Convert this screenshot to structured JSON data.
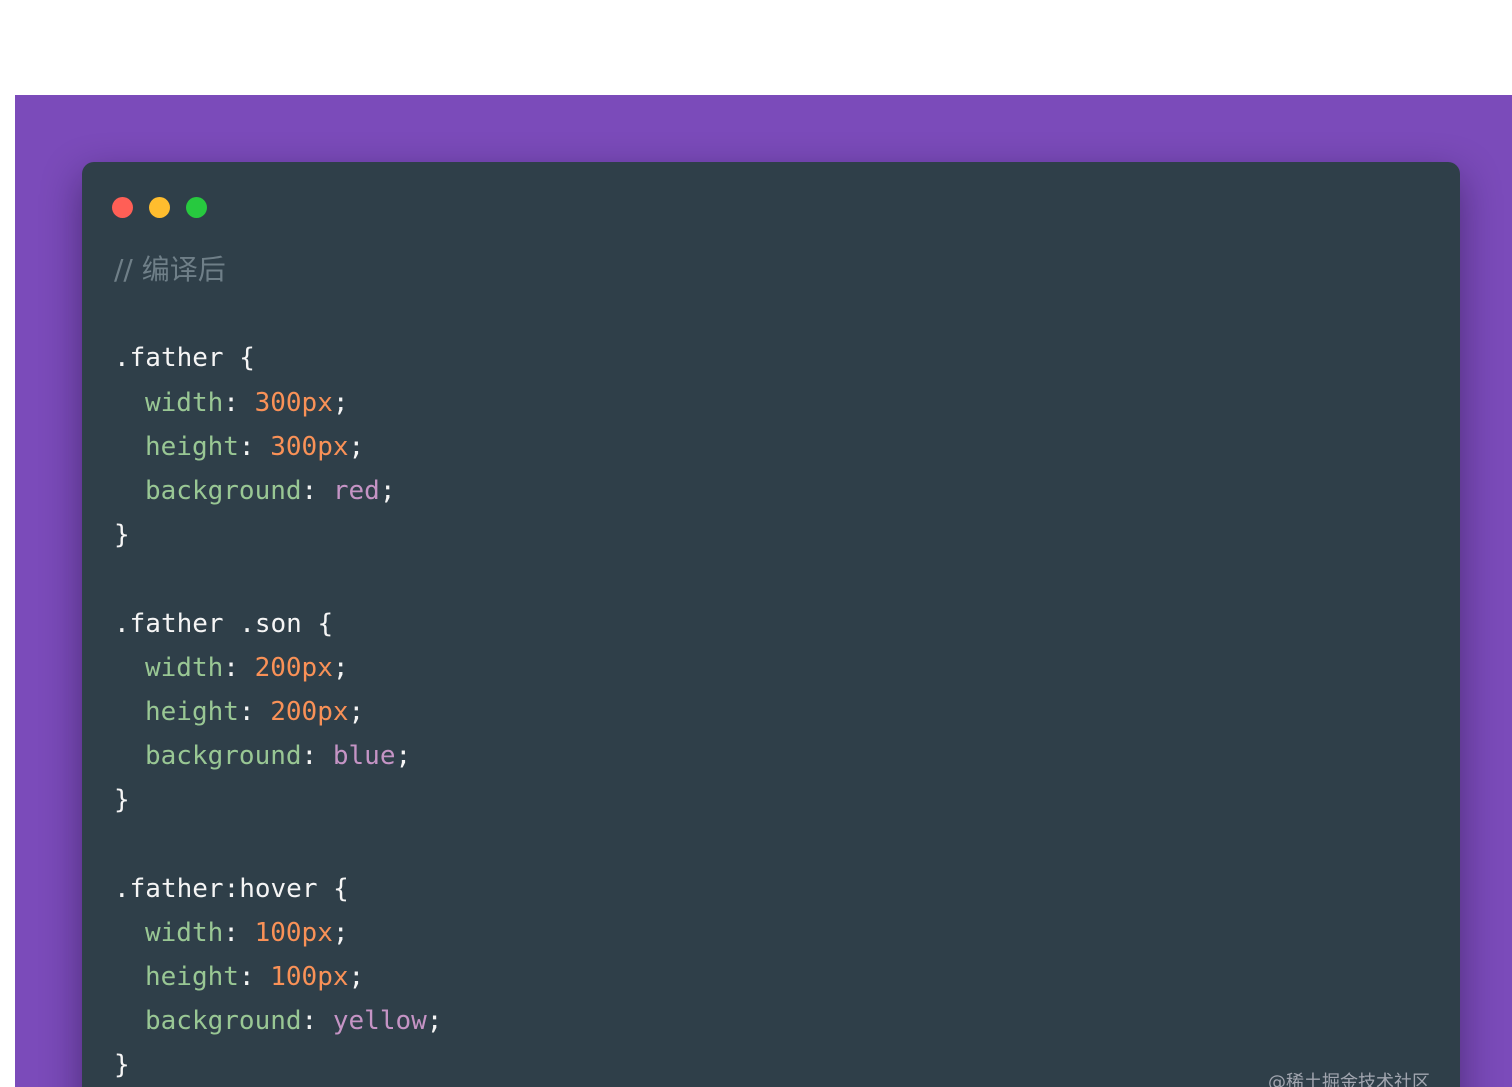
{
  "colors": {
    "backdrop": "#7b4bba",
    "window": "#2f3f49",
    "close_dot": "#ff5f56",
    "minimize_dot": "#ffbd2e",
    "maximize_dot": "#27c93f",
    "comment": "#6f7f88",
    "property": "#99c794",
    "number": "#f99157",
    "identifier": "#c594c5",
    "text": "#f5f5f5"
  },
  "window_controls": [
    "close-dot",
    "minimize-dot",
    "maximize-dot"
  ],
  "code": {
    "comment": "// 编译后",
    "blocks": [
      {
        "selector": ".father {",
        "declarations": [
          {
            "property": "width",
            "colon": ": ",
            "value": "300px",
            "value_type": "number",
            "semicolon": ";"
          },
          {
            "property": "height",
            "colon": ": ",
            "value": "300px",
            "value_type": "number",
            "semicolon": ";"
          },
          {
            "property": "background",
            "colon": ": ",
            "value": "red",
            "value_type": "ident",
            "semicolon": ";"
          }
        ],
        "close": "}"
      },
      {
        "selector": ".father .son {",
        "declarations": [
          {
            "property": "width",
            "colon": ": ",
            "value": "200px",
            "value_type": "number",
            "semicolon": ";"
          },
          {
            "property": "height",
            "colon": ": ",
            "value": "200px",
            "value_type": "number",
            "semicolon": ";"
          },
          {
            "property": "background",
            "colon": ": ",
            "value": "blue",
            "value_type": "ident",
            "semicolon": ";"
          }
        ],
        "close": "}"
      },
      {
        "selector": ".father:hover {",
        "declarations": [
          {
            "property": "width",
            "colon": ": ",
            "value": "100px",
            "value_type": "number",
            "semicolon": ";"
          },
          {
            "property": "height",
            "colon": ": ",
            "value": "100px",
            "value_type": "number",
            "semicolon": ";"
          },
          {
            "property": "background",
            "colon": ": ",
            "value": "yellow",
            "value_type": "ident",
            "semicolon": ";"
          }
        ],
        "close": "}"
      }
    ]
  },
  "watermark": "@稀土掘金技术社区"
}
